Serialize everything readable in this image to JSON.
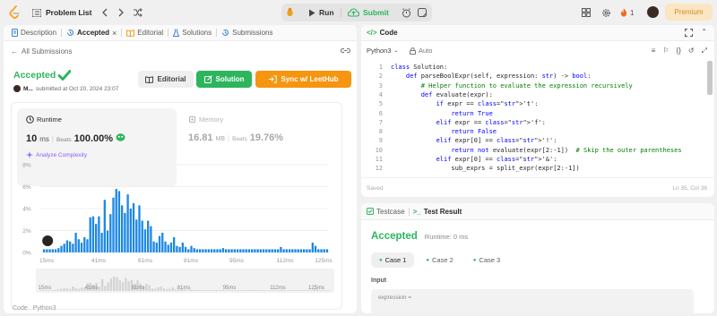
{
  "topbar": {
    "problem_list": "Problem List",
    "run": "Run",
    "submit": "Submit",
    "streak": "1",
    "premium": "Premium"
  },
  "left": {
    "tabs": [
      "Description",
      "Accepted",
      "Editorial",
      "Solutions",
      "Submissions"
    ],
    "all_submissions": "All Submissions",
    "status": "Accepted",
    "user": "M...",
    "submitted": "submitted at Oct 20, 2024 23:07",
    "editorial_btn": "Editorial",
    "solution_btn": "Solution",
    "sync_btn": "Sync w/ LeetHub",
    "runtime_label": "Runtime",
    "runtime_value": "10",
    "runtime_unit": "ms",
    "beats_label": "Beats",
    "runtime_beats": "100.00%",
    "analyze": "Analyze Complexity",
    "memory_label": "Memory",
    "memory_value": "16.81",
    "memory_unit": "MB",
    "memory_beats": "19.76%",
    "footer_tabs": [
      "Code",
      "Python3"
    ]
  },
  "chart_data": {
    "type": "bar",
    "ylabels": [
      "8%",
      "6%",
      "4%",
      "2%",
      "0%"
    ],
    "ylim": [
      0,
      8
    ],
    "xlabels": [
      "15ms",
      "41ms",
      "61ms",
      "81ms",
      "95ms",
      "112ms",
      "125ms"
    ],
    "values": [
      0.3,
      0.3,
      0.3,
      0.3,
      0.3,
      0.4,
      0.6,
      0.8,
      1.1,
      1.0,
      0.8,
      1.8,
      1.2,
      0.9,
      1.4,
      1.2,
      3.2,
      3.3,
      2.6,
      3.3,
      1.8,
      4.8,
      2.0,
      3.5,
      5.0,
      5.8,
      5.6,
      4.3,
      3.6,
      5.3,
      4.0,
      4.5,
      3.0,
      4.3,
      2.9,
      2.1,
      2.9,
      2.4,
      1.0,
      0.9,
      1.5,
      1.8,
      1.0,
      0.7,
      0.9,
      1.4,
      0.6,
      0.5,
      0.9,
      0.5,
      0.3,
      0.6,
      0.4,
      0.3,
      0.3,
      0.3,
      0.3,
      0.3,
      0.3,
      0.3,
      0.3,
      0.3,
      0.4,
      0.3,
      0.3,
      0.3,
      0.3,
      0.3,
      0.3,
      0.3,
      0.3,
      0.3,
      0.3,
      0.3,
      0.3,
      0.3,
      0.3,
      0.3,
      0.3,
      0.3,
      0.3,
      0.3,
      0.5,
      0.3,
      0.3,
      0.3,
      0.3,
      0.3,
      0.3,
      0.3,
      0.3,
      0.3,
      0.3,
      0.9,
      0.6,
      0.3,
      0.3,
      0.3,
      0.3
    ],
    "mini_values": [
      0.3,
      0.3,
      0.3,
      0.3,
      0.3,
      0.4,
      0.6,
      0.8,
      1.1,
      1.0,
      0.8,
      1.8,
      1.2,
      0.9,
      1.4,
      1.2,
      3.2,
      3.3,
      2.6,
      3.3,
      1.8,
      4.8,
      2.0,
      3.5,
      5.0,
      5.8,
      5.6,
      4.3,
      3.6,
      5.3,
      4.0,
      4.5,
      3.0,
      4.3,
      2.9,
      2.1,
      2.9,
      2.4,
      1.0,
      0.9,
      1.5,
      1.8,
      1.0,
      0.7,
      0.9,
      1.4,
      0.6,
      0.5,
      0.9,
      0.5,
      0.3,
      0.6,
      0.4,
      0.3,
      0.3,
      0.3,
      0.3,
      0.3,
      0.3,
      0.3,
      0.3,
      0.3,
      0.4,
      0.3,
      0.3,
      0.3,
      0.3,
      0.3,
      0.3,
      0.3,
      0.3,
      0.3,
      0.3,
      0.3,
      0.3,
      0.3,
      0.3,
      0.3,
      0.3,
      0.3,
      0.3,
      0.3,
      0.5,
      0.3,
      0.3,
      0.3,
      0.3,
      0.3,
      0.3,
      0.3,
      0.3,
      0.3,
      0.3,
      0.9,
      0.6,
      0.3,
      0.3,
      0.3,
      0.3
    ],
    "highlight_index": 0,
    "color": "#1d88e5",
    "grid": true
  },
  "code": {
    "title": "Code",
    "language": "Python3",
    "auto": "Auto",
    "saved": "Saved",
    "cursor": "Ln 35, Col 36",
    "lines": [
      "class Solution:",
      "    def parseBoolExpr(self, expression: str) -> bool:",
      "        # Helper function to evaluate the expression recursively",
      "        def evaluate(expr):",
      "            if expr == 't':",
      "                return True",
      "            elif expr == 'f':",
      "                return False",
      "            elif expr[0] == '!':",
      "                return not evaluate(expr[2:-1])  # Skip the outer parentheses",
      "            elif expr[0] == '&':",
      "                sub_exprs = split_expr(expr[2:-1])"
    ]
  },
  "result": {
    "testcase_tab": "Testcase",
    "result_tab": "Test Result",
    "status": "Accepted",
    "runtime": "Runtime: 0 ms",
    "cases": [
      "Case 1",
      "Case 2",
      "Case 3"
    ],
    "input_label": "Input",
    "expression_label": "expression ="
  },
  "colors": {
    "accent_green": "#2db55d",
    "orange": "#f59510",
    "blue_bar": "#1d88e5",
    "purple": "#8c5cf5"
  }
}
